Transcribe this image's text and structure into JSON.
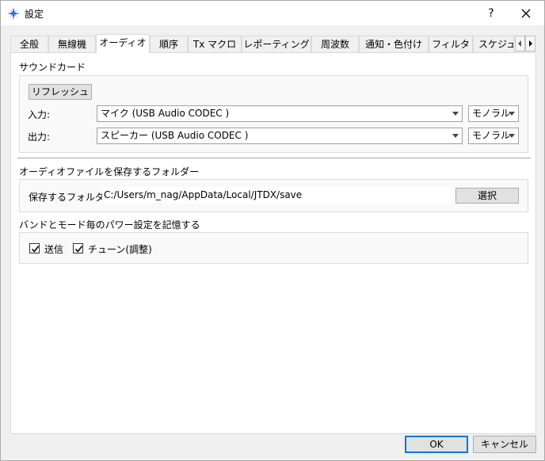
{
  "window": {
    "title": "設定",
    "help_label": "?"
  },
  "tabs": [
    {
      "label": "全般",
      "active": false
    },
    {
      "label": "無線機",
      "active": false
    },
    {
      "label": "オーディオ",
      "active": true
    },
    {
      "label": "順序",
      "active": false
    },
    {
      "label": "Tx マクロ",
      "active": false
    },
    {
      "label": "レポーティング",
      "active": false
    },
    {
      "label": "周波数",
      "active": false
    },
    {
      "label": "通知・色付け",
      "active": false
    },
    {
      "label": "フィルタ",
      "active": false
    },
    {
      "label": "スケジュ",
      "active": false
    }
  ],
  "soundcard": {
    "heading": "サウンドカード",
    "refresh_label": "リフレッシュ",
    "input_label": "入力:",
    "input_device": "マイク (USB Audio CODEC )",
    "input_channel": "モノラル",
    "output_label": "出力:",
    "output_device": "スピーカー (USB Audio CODEC )",
    "output_channel": "モノラル"
  },
  "save_folder": {
    "heading": "オーディオファイルを保存するフォルダー",
    "label": "保存するフォルダー:",
    "path": "C:/Users/m_nag/AppData/Local/JTDX/save",
    "select_label": "選択"
  },
  "power": {
    "heading": "バンドとモード毎のパワー設定を記憶する",
    "transmit_label": "送信",
    "transmit_checked": true,
    "tune_label": "チューン(調整)",
    "tune_checked": true
  },
  "footer": {
    "ok_label": "OK",
    "cancel_label": "キャンセル"
  },
  "colors": {
    "accent": "#0078d7",
    "icon_blue": "#1f5fbf"
  }
}
